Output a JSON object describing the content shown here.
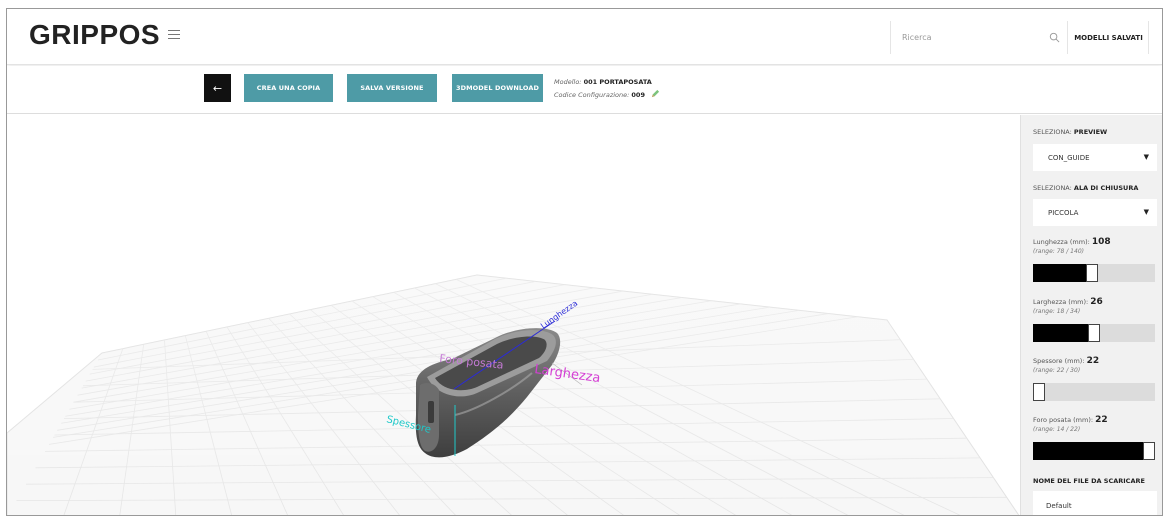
{
  "header": {
    "logo": "GRIPPOS",
    "search_placeholder": "Ricerca",
    "saved_models_label": "MODELLI SALVATI"
  },
  "toolbar": {
    "back_label": "←",
    "copy_label": "CREA UNA COPIA",
    "save_version_label": "SALVA VERSIONE",
    "download_label": "3DMODEL DOWNLOAD",
    "model_prefix": "Modello:",
    "model_value": "001 PORTAPOSATA",
    "config_prefix": "Codice Configurazione:",
    "config_value": "009"
  },
  "viewport": {
    "labels": {
      "lunghezza": "Lunghezza",
      "larghezza": "Larghezza",
      "spessore": "Spessore",
      "foro": "Foro posata"
    },
    "colors": {
      "grid": "#e6e6e6",
      "model": "#5a5a5a",
      "lunghezza": "#2b2bd6",
      "larghezza": "#d43fd4",
      "spessore": "#1fc9c9"
    }
  },
  "panel": {
    "preview": {
      "label_prefix": "SELEZIONA:",
      "label_value": "PREVIEW",
      "selected": "CON_GUIDE"
    },
    "ala": {
      "label_prefix": "SELEZIONA:",
      "label_value": "ALA DI CHIUSURA",
      "selected": "PICCOLA"
    },
    "lunghezza": {
      "label": "Lunghezza (mm):",
      "value": "108",
      "range": "(range: 78 / 140)",
      "fraction": 0.48
    },
    "larghezza": {
      "label": "Larghezza (mm):",
      "value": "26",
      "range": "(range: 18 / 34)",
      "fraction": 0.5
    },
    "spessore": {
      "label": "Spessore (mm):",
      "value": "22",
      "range": "(range: 22 / 30)",
      "fraction": 0.0
    },
    "foro": {
      "label": "Foro posata (mm):",
      "value": "22",
      "range": "(range: 14 / 22)",
      "fraction": 1.0
    },
    "filename": {
      "label": "NOME DEL FILE DA SCARICARE",
      "value": "Default"
    }
  }
}
